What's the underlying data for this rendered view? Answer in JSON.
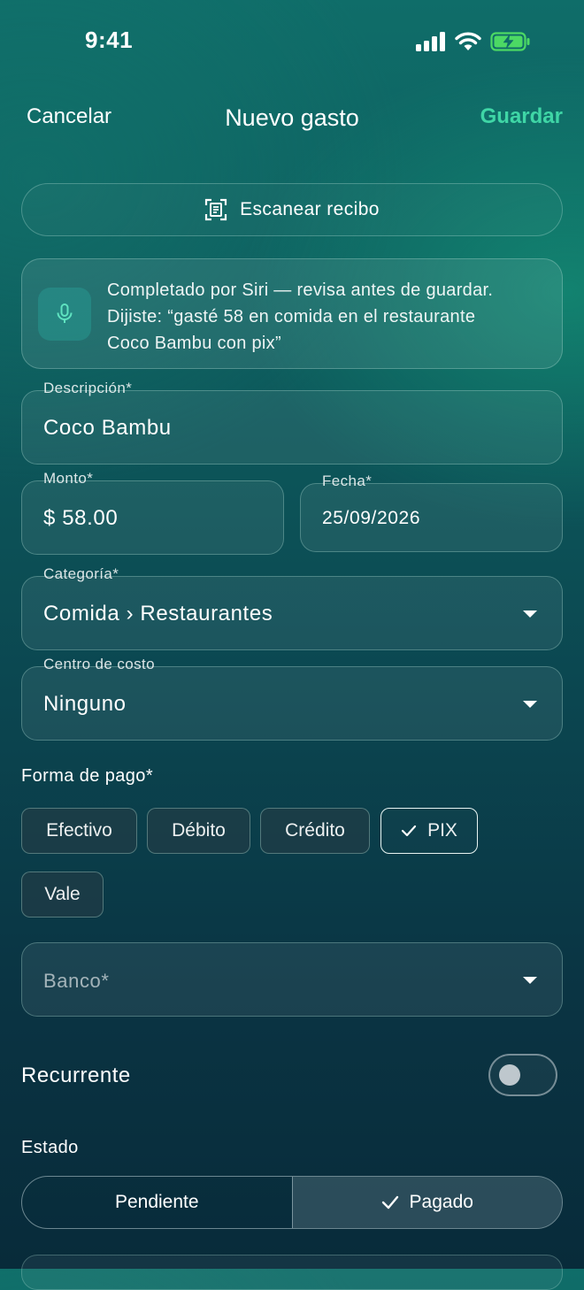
{
  "status_bar": {
    "time": "9:41"
  },
  "nav": {
    "cancel": "Cancelar",
    "title": "Nuevo gasto",
    "save": "Guardar"
  },
  "scan": {
    "label": "Escanear recibo",
    "icon": "scan-document-icon"
  },
  "siri": {
    "icon": "microphone-icon",
    "lines": [
      "Completado por Siri — revisa antes de guardar.",
      "Dijiste: “gasté 58 en comida en el restaurante",
      "Coco Bambu con pix”"
    ]
  },
  "fields": {
    "description": {
      "label": "Descripción*",
      "value": "Coco Bambu"
    },
    "amount": {
      "label": "Monto*",
      "value": "$ 58.00"
    },
    "date": {
      "label": "Fecha*",
      "value": "25/09/2026"
    },
    "category": {
      "label": "Categoría*",
      "value": "Comida › Restaurantes"
    },
    "cost_center": {
      "label": "Centro de costo",
      "value": "Ninguno"
    },
    "bank": {
      "placeholder": "Banco*"
    }
  },
  "payment": {
    "label": "Forma de pago*",
    "options": [
      "Efectivo",
      "Débito",
      "Crédito",
      "PIX",
      "Vale"
    ],
    "selected": "PIX"
  },
  "recurring": {
    "label": "Recurrente",
    "on": false
  },
  "status": {
    "label": "Estado",
    "options": [
      "Pendiente",
      "Pagado"
    ],
    "selected": "Pagado"
  },
  "colors": {
    "accent": "#3fd6a6"
  }
}
